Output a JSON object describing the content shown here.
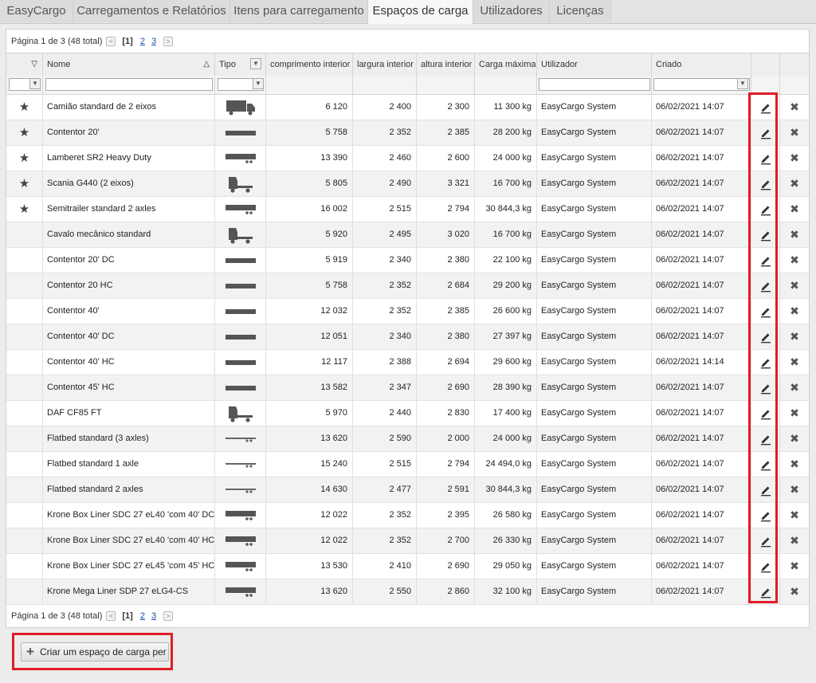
{
  "tabs": [
    {
      "label": "EasyCargo"
    },
    {
      "label": "Carregamentos e Relatórios"
    },
    {
      "label": "Itens para carregamento"
    },
    {
      "label": "Espaços de carga"
    },
    {
      "label": "Utilizadores"
    },
    {
      "label": "Licenças"
    }
  ],
  "pager": {
    "text": "Página 1 de 3 (48 total)",
    "current": "[1]",
    "page2": "2",
    "page3": "3",
    "prev": "<",
    "next": ">"
  },
  "columns": {
    "sort": "▽",
    "name": "Nome",
    "name_sort": "△",
    "type": "Tipo",
    "length": "comprimento interior",
    "width": "largura interior",
    "height": "altura interior",
    "load": "Carga máxima",
    "user": "Utilizador",
    "created": "Criado"
  },
  "rows": [
    {
      "star": "★",
      "name": "Camião standard de 2 eixos",
      "icon": "truck-icon",
      "length": "6 120",
      "width": "2 400",
      "height": "2 300",
      "load": "11 300 kg",
      "user": "EasyCargo System",
      "created": "06/02/2021 14:07"
    },
    {
      "star": "★",
      "name": "Contentor 20'",
      "icon": "container-icon",
      "length": "5 758",
      "width": "2 352",
      "height": "2 385",
      "load": "28 200 kg",
      "user": "EasyCargo System",
      "created": "06/02/2021 14:07"
    },
    {
      "star": "★",
      "name": "Lamberet SR2 Heavy Duty",
      "icon": "semitrailer-icon",
      "length": "13 390",
      "width": "2 460",
      "height": "2 600",
      "load": "24 000 kg",
      "user": "EasyCargo System",
      "created": "06/02/2021 14:07"
    },
    {
      "star": "★",
      "name": "Scania G440 (2 eixos)",
      "icon": "tractor-icon",
      "length": "5 805",
      "width": "2 490",
      "height": "3 321",
      "load": "16 700 kg",
      "user": "EasyCargo System",
      "created": "06/02/2021 14:07"
    },
    {
      "star": "★",
      "name": "Semitrailer standard 2 axles",
      "icon": "semitrailer-icon",
      "length": "16 002",
      "width": "2 515",
      "height": "2 794",
      "load": "30 844,3 kg",
      "user": "EasyCargo System",
      "created": "06/02/2021 14:07"
    },
    {
      "star": "",
      "name": "Cavalo mecânico standard",
      "icon": "tractor-icon",
      "length": "5 920",
      "width": "2 495",
      "height": "3 020",
      "load": "16 700 kg",
      "user": "EasyCargo System",
      "created": "06/02/2021 14:07"
    },
    {
      "star": "",
      "name": "Contentor 20' DC",
      "icon": "container-icon",
      "length": "5 919",
      "width": "2 340",
      "height": "2 380",
      "load": "22 100 kg",
      "user": "EasyCargo System",
      "created": "06/02/2021 14:07"
    },
    {
      "star": "",
      "name": "Contentor 20 HC",
      "icon": "container-icon",
      "length": "5 758",
      "width": "2 352",
      "height": "2 684",
      "load": "29 200 kg",
      "user": "EasyCargo System",
      "created": "06/02/2021 14:07"
    },
    {
      "star": "",
      "name": "Contentor 40'",
      "icon": "container-icon",
      "length": "12 032",
      "width": "2 352",
      "height": "2 385",
      "load": "26 600 kg",
      "user": "EasyCargo System",
      "created": "06/02/2021 14:07"
    },
    {
      "star": "",
      "name": "Contentor 40' DC",
      "icon": "container-icon",
      "length": "12 051",
      "width": "2 340",
      "height": "2 380",
      "load": "27 397 kg",
      "user": "EasyCargo System",
      "created": "06/02/2021 14:07"
    },
    {
      "star": "",
      "name": "Contentor 40' HC",
      "icon": "container-icon",
      "length": "12 117",
      "width": "2 388",
      "height": "2 694",
      "load": "29 600 kg",
      "user": "EasyCargo System",
      "created": "06/02/2021 14:14"
    },
    {
      "star": "",
      "name": "Contentor 45' HC",
      "icon": "container-icon",
      "length": "13 582",
      "width": "2 347",
      "height": "2 690",
      "load": "28 390 kg",
      "user": "EasyCargo System",
      "created": "06/02/2021 14:07"
    },
    {
      "star": "",
      "name": "DAF CF85 FT",
      "icon": "tractor-icon",
      "length": "5 970",
      "width": "2 440",
      "height": "2 830",
      "load": "17 400 kg",
      "user": "EasyCargo System",
      "created": "06/02/2021 14:07"
    },
    {
      "star": "",
      "name": "Flatbed standard (3 axles)",
      "icon": "flatbed-icon",
      "length": "13 620",
      "width": "2 590",
      "height": "2 000",
      "load": "24 000 kg",
      "user": "EasyCargo System",
      "created": "06/02/2021 14:07"
    },
    {
      "star": "",
      "name": "Flatbed standard 1 axle",
      "icon": "flatbed-icon",
      "length": "15 240",
      "width": "2 515",
      "height": "2 794",
      "load": "24 494,0 kg",
      "user": "EasyCargo System",
      "created": "06/02/2021 14:07"
    },
    {
      "star": "",
      "name": "Flatbed standard 2 axles",
      "icon": "flatbed-icon",
      "length": "14 630",
      "width": "2 477",
      "height": "2 591",
      "load": "30 844,3 kg",
      "user": "EasyCargo System",
      "created": "06/02/2021 14:07"
    },
    {
      "star": "",
      "name": "Krone Box Liner SDC 27 eL40 'com 40' DC",
      "icon": "semitrailer-icon",
      "length": "12 022",
      "width": "2 352",
      "height": "2 395",
      "load": "26 580 kg",
      "user": "EasyCargo System",
      "created": "06/02/2021 14:07"
    },
    {
      "star": "",
      "name": "Krone Box Liner SDC 27 eL40 'com 40' HC",
      "icon": "semitrailer-icon",
      "length": "12 022",
      "width": "2 352",
      "height": "2 700",
      "load": "26 330 kg",
      "user": "EasyCargo System",
      "created": "06/02/2021 14:07"
    },
    {
      "star": "",
      "name": "Krone Box Liner SDC 27 eL45 'com 45' HC",
      "icon": "semitrailer-icon",
      "length": "13 530",
      "width": "2 410",
      "height": "2 690",
      "load": "29 050 kg",
      "user": "EasyCargo System",
      "created": "06/02/2021 14:07"
    },
    {
      "star": "",
      "name": "Krone Mega Liner SDP 27 eLG4-CS",
      "icon": "semitrailer-icon",
      "length": "13 620",
      "width": "2 550",
      "height": "2 860",
      "load": "32 100 kg",
      "user": "EasyCargo System",
      "created": "06/02/2021 14:07"
    }
  ],
  "actions": {
    "edit_icon": "pencil-icon",
    "delete_glyph": "✖"
  },
  "create_button": {
    "label": "Criar um espaço de carga per"
  },
  "colors": {
    "highlight": "#e01d27",
    "link": "#1a4fa6"
  }
}
